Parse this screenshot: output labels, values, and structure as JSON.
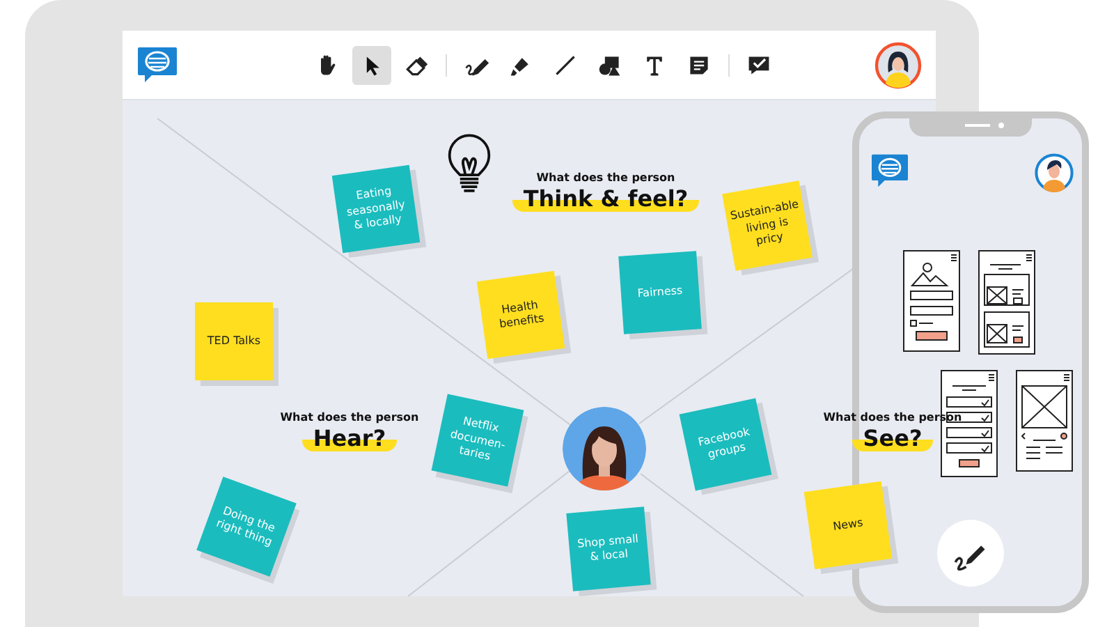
{
  "toolbar": {
    "tools": [
      {
        "kind": "hand",
        "selected": false
      },
      {
        "kind": "pointer",
        "selected": true
      },
      {
        "kind": "eraser",
        "selected": false
      },
      {
        "kind": "divider"
      },
      {
        "kind": "pen",
        "selected": false
      },
      {
        "kind": "highlighter",
        "selected": false
      },
      {
        "kind": "line",
        "selected": false
      },
      {
        "kind": "shapes",
        "selected": false
      },
      {
        "kind": "text",
        "selected": false
      },
      {
        "kind": "note",
        "selected": false
      },
      {
        "kind": "divider"
      },
      {
        "kind": "comment",
        "selected": false
      }
    ]
  },
  "board": {
    "labels": [
      {
        "question": "What does the person",
        "title": "Think & feel?"
      },
      {
        "question": "What does the person",
        "title": "Hear?"
      },
      {
        "question": "What does the person",
        "title": "See?"
      }
    ],
    "notes": [
      {
        "text": "Eating seasonally & locally",
        "color": "#1bbcbe"
      },
      {
        "text": "Sustain-able living is pricy",
        "color": "#ffde1f"
      },
      {
        "text": "Health benefits",
        "color": "#ffde1f"
      },
      {
        "text": "Fairness",
        "color": "#1bbcbe"
      },
      {
        "text": "TED Talks",
        "color": "#ffde1f"
      },
      {
        "text": "Netflix documen-taries",
        "color": "#1bbcbe"
      },
      {
        "text": "Facebook groups",
        "color": "#1bbcbe"
      },
      {
        "text": "Doing the right thing",
        "color": "#1bbcbe"
      },
      {
        "text": "Shop small & local",
        "color": "#1bbcbe"
      },
      {
        "text": "News",
        "color": "#ffde1f"
      }
    ]
  }
}
